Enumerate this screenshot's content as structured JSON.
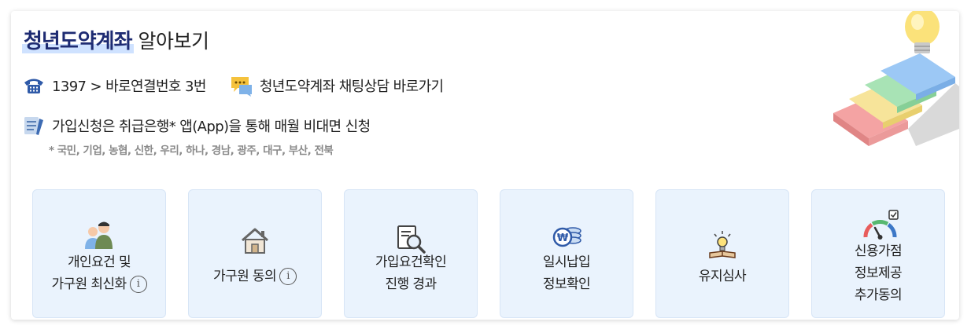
{
  "header": {
    "title_strong": "청년도약계좌",
    "title_light": "알아보기"
  },
  "contact": {
    "phone_text": "1397 > 바로연결번호 3번",
    "chat_text": "청년도약계좌 채팅상담 바로가기"
  },
  "apply": {
    "text": "가입신청은 취급은행* 앱(App)을 통해 매월 비대면 신청",
    "note": "* 국민, 기업, 농협, 신한, 우리, 하나, 경남, 광주, 대구, 부산, 전북"
  },
  "cards": [
    {
      "line1": "개인요건 및",
      "line2": "가구원 최신화",
      "info": "i"
    },
    {
      "line1": "가구원 동의",
      "info": "i"
    },
    {
      "line1": "가입요건확인",
      "line2": "진행 경과"
    },
    {
      "line1": "일시납입",
      "line2": "정보확인"
    },
    {
      "line1": "유지심사"
    },
    {
      "line1": "신용가점",
      "line2": "정보제공",
      "line3": "추가동의"
    }
  ],
  "icons": [
    "phone-icon",
    "chat-icon",
    "document-icon",
    "people-icon",
    "house-icon",
    "search-document-icon",
    "coins-icon",
    "lightbulb-book-icon",
    "credit-gauge-icon",
    "stairs-lightbulb-illustration"
  ]
}
